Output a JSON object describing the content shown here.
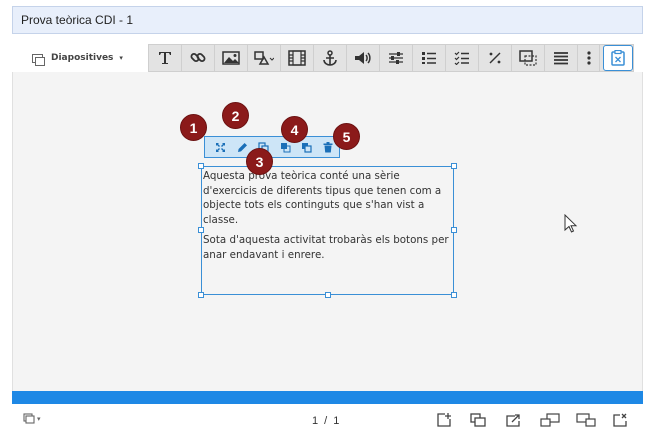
{
  "title_field": {
    "value": "Prova teòrica CDI - 1"
  },
  "toolbar": {
    "slides_menu_label": "Diapositives",
    "slides_menu_caret": "▾",
    "tools": [
      {
        "name": "text-tool-icon",
        "glyph": "T"
      },
      {
        "name": "link-tool-icon",
        "glyph": "link"
      },
      {
        "name": "image-tool-icon",
        "glyph": "image"
      },
      {
        "name": "shape-tool-icon",
        "glyph": "shape"
      },
      {
        "name": "video-tool-icon",
        "glyph": "film"
      },
      {
        "name": "anchor-tool-icon",
        "glyph": "anchor"
      },
      {
        "name": "audio-tool-icon",
        "glyph": "volume"
      },
      {
        "name": "sliders-tool-icon",
        "glyph": "sliders"
      },
      {
        "name": "ordered-list-tool-icon",
        "glyph": "olist"
      },
      {
        "name": "checklist-tool-icon",
        "glyph": "checklist"
      },
      {
        "name": "percent-tool-icon",
        "glyph": "%"
      },
      {
        "name": "overlay-tool-icon",
        "glyph": "overlay"
      },
      {
        "name": "list-tool-icon",
        "glyph": "list"
      },
      {
        "name": "more-tool-icon",
        "glyph": "more"
      },
      {
        "name": "clipboard-tool-icon",
        "glyph": "clipboard"
      }
    ]
  },
  "textbox": {
    "paragraph_1": "Aquesta prova teòrica conté una sèrie d'exercicis de diferents tipus que tenen com a objecte tots els continguts que s'han vist a classe.",
    "paragraph_2": "Sota d'aquesta activitat trobaràs els botons per anar endavant i enrere."
  },
  "edit_toolbar": {
    "buttons": [
      "move-icon",
      "edit-pencil-icon",
      "duplicate-icon",
      "bring-front-icon",
      "send-back-icon",
      "delete-trash-icon"
    ]
  },
  "badges": [
    "1",
    "2",
    "3",
    "4",
    "5"
  ],
  "footer": {
    "page_counter": "1 / 1",
    "slides_caret": "▾"
  },
  "colors": {
    "accent": "#1e88e5",
    "badge": "#8b1a1a",
    "selection": "#3a8fd6"
  }
}
